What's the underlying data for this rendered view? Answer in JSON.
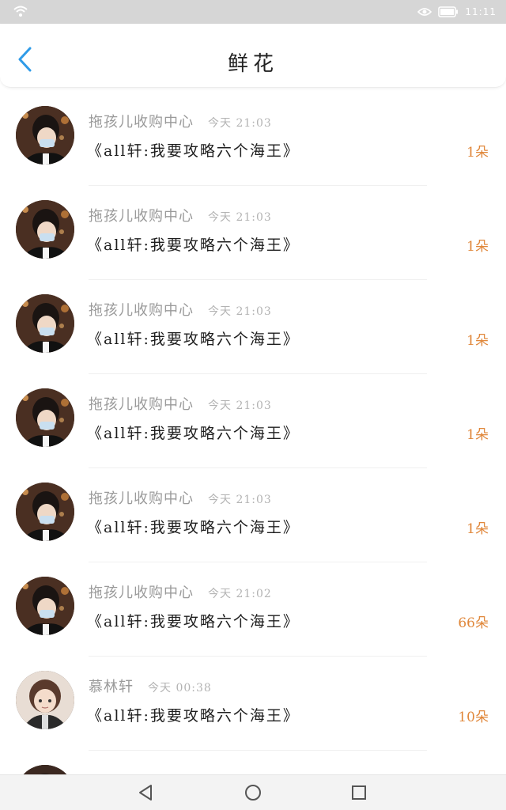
{
  "status_bar": {
    "time": "11:11"
  },
  "header": {
    "title": "鲜花"
  },
  "items": [
    {
      "name": "拖孩儿收购中心",
      "time": "今天 21:03",
      "book": "《all轩:我要攻略六个海王》",
      "count": "1朵",
      "avatar": "masked-person-avatar"
    },
    {
      "name": "拖孩儿收购中心",
      "time": "今天 21:03",
      "book": "《all轩:我要攻略六个海王》",
      "count": "1朵",
      "avatar": "masked-person-avatar"
    },
    {
      "name": "拖孩儿收购中心",
      "time": "今天 21:03",
      "book": "《all轩:我要攻略六个海王》",
      "count": "1朵",
      "avatar": "masked-person-avatar"
    },
    {
      "name": "拖孩儿收购中心",
      "time": "今天 21:03",
      "book": "《all轩:我要攻略六个海王》",
      "count": "1朵",
      "avatar": "masked-person-avatar"
    },
    {
      "name": "拖孩儿收购中心",
      "time": "今天 21:03",
      "book": "《all轩:我要攻略六个海王》",
      "count": "1朵",
      "avatar": "masked-person-avatar"
    },
    {
      "name": "拖孩儿收购中心",
      "time": "今天 21:02",
      "book": "《all轩:我要攻略六个海王》",
      "count": "66朵",
      "avatar": "masked-person-avatar"
    },
    {
      "name": "慕林轩",
      "time": "今天 00:38",
      "book": "《all轩:我要攻略六个海王》",
      "count": "10朵",
      "avatar": "cartoon-person-avatar"
    },
    {
      "name": "",
      "time": "",
      "book": "",
      "count": "",
      "avatar": "partial-avatar"
    }
  ],
  "nav": {
    "back": "back-triangle-icon",
    "home": "home-circle-icon",
    "recents": "recents-square-icon"
  },
  "colors": {
    "accent_blue": "#2f9be8",
    "count_orange": "#e0873a",
    "status_bar": "#d6d6d6"
  }
}
